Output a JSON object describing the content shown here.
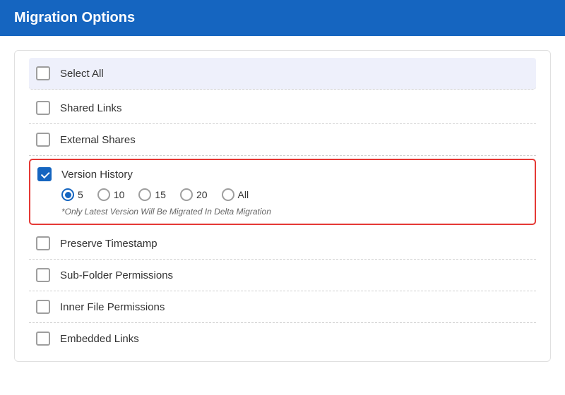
{
  "header": {
    "title": "Migration Options",
    "bg_color": "#1565C0"
  },
  "options": {
    "select_all": {
      "label": "Select All",
      "checked": false
    },
    "items": [
      {
        "id": "shared-links",
        "label": "Shared Links",
        "checked": false,
        "has_sub": false
      },
      {
        "id": "external-shares",
        "label": "External Shares",
        "checked": false,
        "has_sub": false
      },
      {
        "id": "version-history",
        "label": "Version History",
        "checked": true,
        "has_sub": true,
        "radio_options": [
          "5",
          "10",
          "15",
          "20",
          "All"
        ],
        "radio_selected": "5",
        "note": "*Only Latest Version Will Be Migrated In Delta Migration"
      },
      {
        "id": "preserve-timestamp",
        "label": "Preserve Timestamp",
        "checked": false,
        "has_sub": false
      },
      {
        "id": "sub-folder-permissions",
        "label": "Sub-Folder Permissions",
        "checked": false,
        "has_sub": false
      },
      {
        "id": "inner-file-permissions",
        "label": "Inner File Permissions",
        "checked": false,
        "has_sub": false
      },
      {
        "id": "embedded-links",
        "label": "Embedded Links",
        "checked": false,
        "has_sub": false
      }
    ]
  }
}
